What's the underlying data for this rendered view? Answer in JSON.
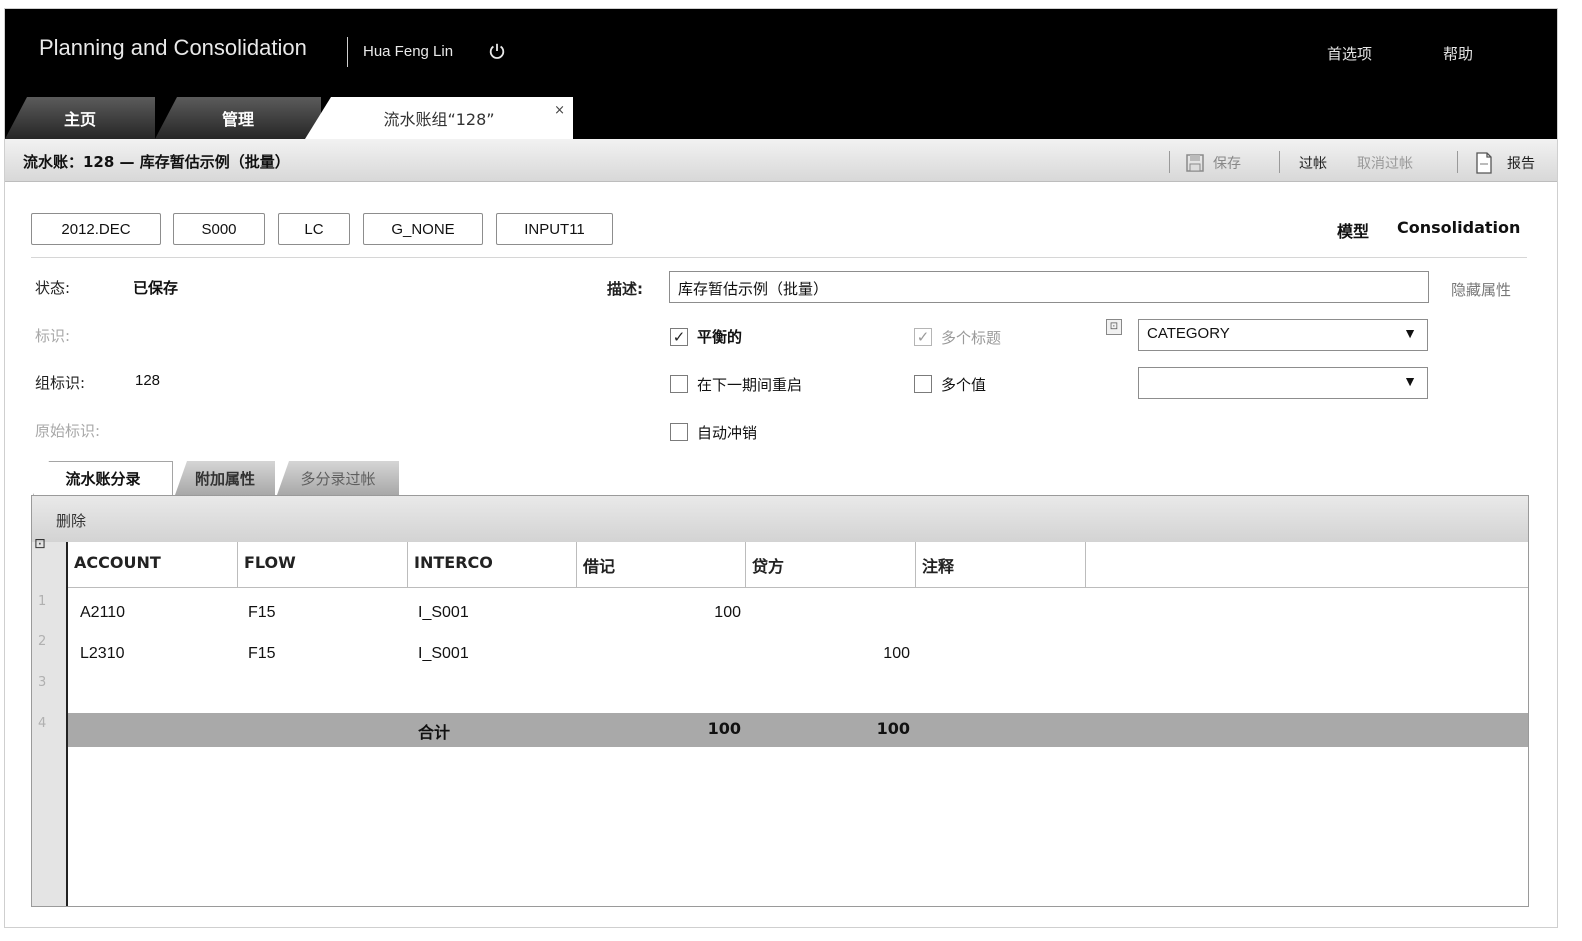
{
  "header": {
    "app_title": "Planning and Consolidation",
    "user": "Hua Feng Lin",
    "preferences": "首选项",
    "help": "帮助"
  },
  "tabs": [
    {
      "label": "主页"
    },
    {
      "label": "管理"
    },
    {
      "label": "流水账组“128”",
      "close": "×"
    }
  ],
  "toolbar": {
    "page_title": "流水账：128 — 库存暂估示例（批量）",
    "save": "保存",
    "post": "过帐",
    "unpost": "取消过帐",
    "report": "报告"
  },
  "dimensions": [
    "2012.DEC",
    "S000",
    "LC",
    "G_NONE",
    "INPUT11"
  ],
  "model": {
    "label": "模型",
    "value": "Consolidation"
  },
  "form": {
    "status_label": "状态:",
    "status_value": "已保存",
    "id_label": "标识:",
    "group_id_label": "组标识:",
    "group_id_value": "128",
    "original_id_label": "原始标识:",
    "desc_label": "描述:",
    "desc_value": "库存暂估示例（批量）",
    "hide_props": "隐藏属性",
    "balanced": "平衡的",
    "multi_header": "多个标题",
    "reopen_next": "在下一期间重启",
    "multi_value": "多个值",
    "auto_reverse": "自动冲销",
    "category_select": "CATEGORY",
    "second_select": ""
  },
  "subtabs": [
    "流水账分录",
    "附加属性",
    "多分录过帐"
  ],
  "grid": {
    "delete": "删除",
    "columns": [
      "ACCOUNT",
      "FLOW",
      "INTERCO",
      "借记",
      "贷方",
      "注释"
    ],
    "rows": [
      {
        "num": "1",
        "account": "A2110",
        "flow": "F15",
        "interco": "I_S001",
        "debit": "100",
        "credit": ""
      },
      {
        "num": "2",
        "account": "L2310",
        "flow": "F15",
        "interco": "I_S001",
        "debit": "",
        "credit": "100"
      },
      {
        "num": "3",
        "account": "",
        "flow": "",
        "interco": "",
        "debit": "",
        "credit": ""
      }
    ],
    "total": {
      "num": "4",
      "label": "合计",
      "debit": "100",
      "credit": "100"
    }
  }
}
